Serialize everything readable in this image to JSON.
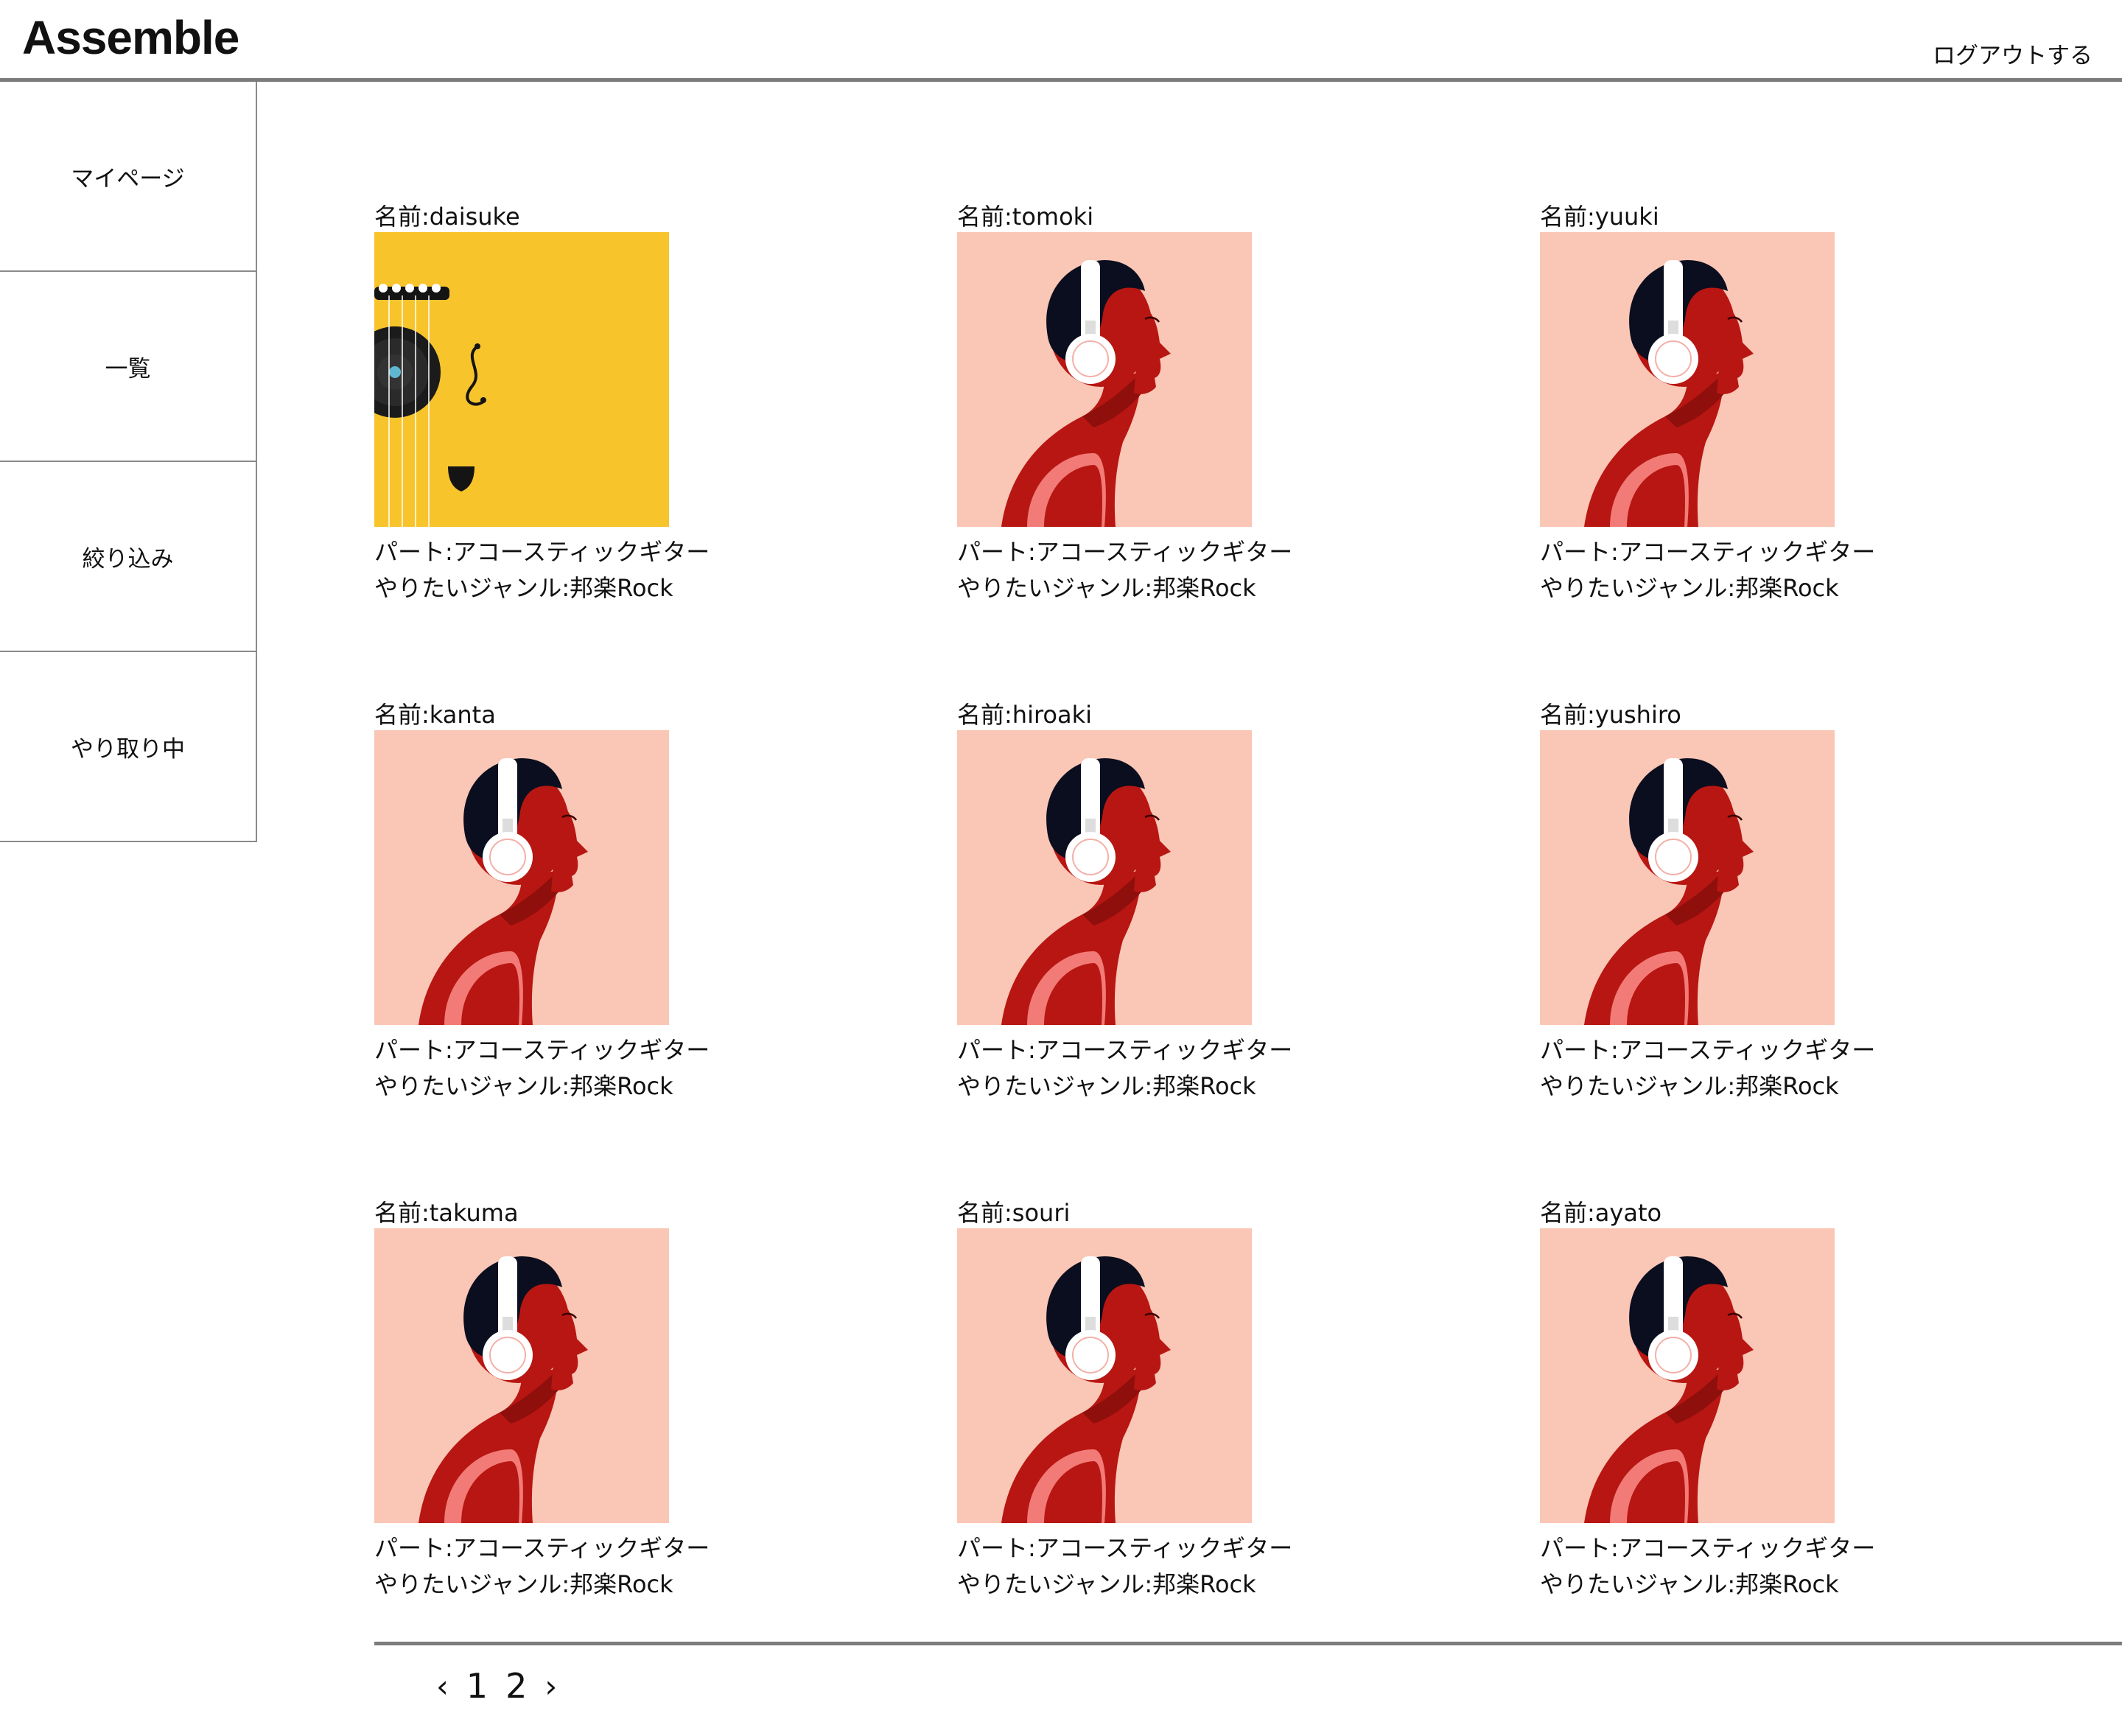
{
  "header": {
    "brand": "Assemble",
    "logout_label": "ログアウトする"
  },
  "sidebar": {
    "items": [
      {
        "label": "マイページ"
      },
      {
        "label": "一覧"
      },
      {
        "label": "絞り込み"
      },
      {
        "label": "やり取り中"
      }
    ]
  },
  "users": [
    {
      "name": "名前:daisuke",
      "part": "パート:アコースティックギター",
      "genre": "やりたいジャンル:邦楽Rock",
      "image": "guitar-illustration"
    },
    {
      "name": "名前:tomoki",
      "part": "パート:アコースティックギター",
      "genre": "やりたいジャンル:邦楽Rock",
      "image": "headphone-listener-illustration"
    },
    {
      "name": "名前:yuuki",
      "part": "パート:アコースティックギター",
      "genre": "やりたいジャンル:邦楽Rock",
      "image": "headphone-listener-illustration"
    },
    {
      "name": "名前:kanta",
      "part": "パート:アコースティックギター",
      "genre": "やりたいジャンル:邦楽Rock",
      "image": "headphone-listener-illustration"
    },
    {
      "name": "名前:hiroaki",
      "part": "パート:アコースティックギター",
      "genre": "やりたいジャンル:邦楽Rock",
      "image": "headphone-listener-illustration"
    },
    {
      "name": "名前:yushiro",
      "part": "パート:アコースティックギター",
      "genre": "やりたいジャンル:邦楽Rock",
      "image": "headphone-listener-illustration"
    },
    {
      "name": "名前:takuma",
      "part": "パート:アコースティックギター",
      "genre": "やりたいジャンル:邦楽Rock",
      "image": "headphone-listener-illustration"
    },
    {
      "name": "名前:souri",
      "part": "パート:アコースティックギター",
      "genre": "やりたいジャンル:邦楽Rock",
      "image": "headphone-listener-illustration"
    },
    {
      "name": "名前:ayato",
      "part": "パート:アコースティックギター",
      "genre": "やりたいジャンル:邦楽Rock",
      "image": "headphone-listener-illustration"
    }
  ],
  "pagination": {
    "prev": "‹",
    "pages": [
      "1",
      "2"
    ],
    "next": "›"
  },
  "colors": {
    "guitar_bg": "#F8C42C",
    "portrait_bg": "#FAC6B5",
    "skin": "#B81612",
    "hair": "#0A0E1E",
    "accent": "#F27B77"
  }
}
